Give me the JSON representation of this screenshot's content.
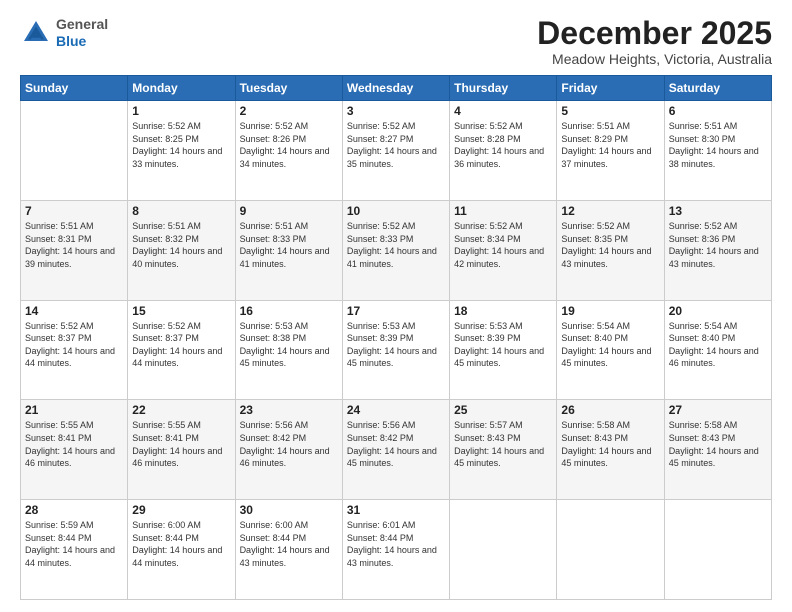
{
  "logo": {
    "general": "General",
    "blue": "Blue"
  },
  "header": {
    "month": "December 2025",
    "location": "Meadow Heights, Victoria, Australia"
  },
  "weekdays": [
    "Sunday",
    "Monday",
    "Tuesday",
    "Wednesday",
    "Thursday",
    "Friday",
    "Saturday"
  ],
  "weeks": [
    [
      {
        "day": "",
        "sunrise": "",
        "sunset": "",
        "daylight": ""
      },
      {
        "day": "1",
        "sunrise": "Sunrise: 5:52 AM",
        "sunset": "Sunset: 8:25 PM",
        "daylight": "Daylight: 14 hours and 33 minutes."
      },
      {
        "day": "2",
        "sunrise": "Sunrise: 5:52 AM",
        "sunset": "Sunset: 8:26 PM",
        "daylight": "Daylight: 14 hours and 34 minutes."
      },
      {
        "day": "3",
        "sunrise": "Sunrise: 5:52 AM",
        "sunset": "Sunset: 8:27 PM",
        "daylight": "Daylight: 14 hours and 35 minutes."
      },
      {
        "day": "4",
        "sunrise": "Sunrise: 5:52 AM",
        "sunset": "Sunset: 8:28 PM",
        "daylight": "Daylight: 14 hours and 36 minutes."
      },
      {
        "day": "5",
        "sunrise": "Sunrise: 5:51 AM",
        "sunset": "Sunset: 8:29 PM",
        "daylight": "Daylight: 14 hours and 37 minutes."
      },
      {
        "day": "6",
        "sunrise": "Sunrise: 5:51 AM",
        "sunset": "Sunset: 8:30 PM",
        "daylight": "Daylight: 14 hours and 38 minutes."
      }
    ],
    [
      {
        "day": "7",
        "sunrise": "Sunrise: 5:51 AM",
        "sunset": "Sunset: 8:31 PM",
        "daylight": "Daylight: 14 hours and 39 minutes."
      },
      {
        "day": "8",
        "sunrise": "Sunrise: 5:51 AM",
        "sunset": "Sunset: 8:32 PM",
        "daylight": "Daylight: 14 hours and 40 minutes."
      },
      {
        "day": "9",
        "sunrise": "Sunrise: 5:51 AM",
        "sunset": "Sunset: 8:33 PM",
        "daylight": "Daylight: 14 hours and 41 minutes."
      },
      {
        "day": "10",
        "sunrise": "Sunrise: 5:52 AM",
        "sunset": "Sunset: 8:33 PM",
        "daylight": "Daylight: 14 hours and 41 minutes."
      },
      {
        "day": "11",
        "sunrise": "Sunrise: 5:52 AM",
        "sunset": "Sunset: 8:34 PM",
        "daylight": "Daylight: 14 hours and 42 minutes."
      },
      {
        "day": "12",
        "sunrise": "Sunrise: 5:52 AM",
        "sunset": "Sunset: 8:35 PM",
        "daylight": "Daylight: 14 hours and 43 minutes."
      },
      {
        "day": "13",
        "sunrise": "Sunrise: 5:52 AM",
        "sunset": "Sunset: 8:36 PM",
        "daylight": "Daylight: 14 hours and 43 minutes."
      }
    ],
    [
      {
        "day": "14",
        "sunrise": "Sunrise: 5:52 AM",
        "sunset": "Sunset: 8:37 PM",
        "daylight": "Daylight: 14 hours and 44 minutes."
      },
      {
        "day": "15",
        "sunrise": "Sunrise: 5:52 AM",
        "sunset": "Sunset: 8:37 PM",
        "daylight": "Daylight: 14 hours and 44 minutes."
      },
      {
        "day": "16",
        "sunrise": "Sunrise: 5:53 AM",
        "sunset": "Sunset: 8:38 PM",
        "daylight": "Daylight: 14 hours and 45 minutes."
      },
      {
        "day": "17",
        "sunrise": "Sunrise: 5:53 AM",
        "sunset": "Sunset: 8:39 PM",
        "daylight": "Daylight: 14 hours and 45 minutes."
      },
      {
        "day": "18",
        "sunrise": "Sunrise: 5:53 AM",
        "sunset": "Sunset: 8:39 PM",
        "daylight": "Daylight: 14 hours and 45 minutes."
      },
      {
        "day": "19",
        "sunrise": "Sunrise: 5:54 AM",
        "sunset": "Sunset: 8:40 PM",
        "daylight": "Daylight: 14 hours and 45 minutes."
      },
      {
        "day": "20",
        "sunrise": "Sunrise: 5:54 AM",
        "sunset": "Sunset: 8:40 PM",
        "daylight": "Daylight: 14 hours and 46 minutes."
      }
    ],
    [
      {
        "day": "21",
        "sunrise": "Sunrise: 5:55 AM",
        "sunset": "Sunset: 8:41 PM",
        "daylight": "Daylight: 14 hours and 46 minutes."
      },
      {
        "day": "22",
        "sunrise": "Sunrise: 5:55 AM",
        "sunset": "Sunset: 8:41 PM",
        "daylight": "Daylight: 14 hours and 46 minutes."
      },
      {
        "day": "23",
        "sunrise": "Sunrise: 5:56 AM",
        "sunset": "Sunset: 8:42 PM",
        "daylight": "Daylight: 14 hours and 46 minutes."
      },
      {
        "day": "24",
        "sunrise": "Sunrise: 5:56 AM",
        "sunset": "Sunset: 8:42 PM",
        "daylight": "Daylight: 14 hours and 45 minutes."
      },
      {
        "day": "25",
        "sunrise": "Sunrise: 5:57 AM",
        "sunset": "Sunset: 8:43 PM",
        "daylight": "Daylight: 14 hours and 45 minutes."
      },
      {
        "day": "26",
        "sunrise": "Sunrise: 5:58 AM",
        "sunset": "Sunset: 8:43 PM",
        "daylight": "Daylight: 14 hours and 45 minutes."
      },
      {
        "day": "27",
        "sunrise": "Sunrise: 5:58 AM",
        "sunset": "Sunset: 8:43 PM",
        "daylight": "Daylight: 14 hours and 45 minutes."
      }
    ],
    [
      {
        "day": "28",
        "sunrise": "Sunrise: 5:59 AM",
        "sunset": "Sunset: 8:44 PM",
        "daylight": "Daylight: 14 hours and 44 minutes."
      },
      {
        "day": "29",
        "sunrise": "Sunrise: 6:00 AM",
        "sunset": "Sunset: 8:44 PM",
        "daylight": "Daylight: 14 hours and 44 minutes."
      },
      {
        "day": "30",
        "sunrise": "Sunrise: 6:00 AM",
        "sunset": "Sunset: 8:44 PM",
        "daylight": "Daylight: 14 hours and 43 minutes."
      },
      {
        "day": "31",
        "sunrise": "Sunrise: 6:01 AM",
        "sunset": "Sunset: 8:44 PM",
        "daylight": "Daylight: 14 hours and 43 minutes."
      },
      {
        "day": "",
        "sunrise": "",
        "sunset": "",
        "daylight": ""
      },
      {
        "day": "",
        "sunrise": "",
        "sunset": "",
        "daylight": ""
      },
      {
        "day": "",
        "sunrise": "",
        "sunset": "",
        "daylight": ""
      }
    ]
  ]
}
